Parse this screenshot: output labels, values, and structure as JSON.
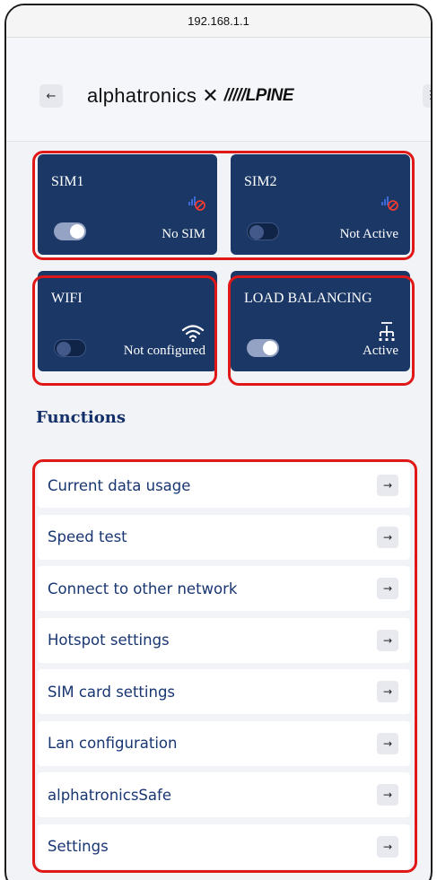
{
  "browser": {
    "url": "192.168.1.1"
  },
  "header": {
    "back_label": "←",
    "menu_label": "☰",
    "logo": {
      "part1": "alphatronics",
      "separator": "✕",
      "part2": "/////LPINE"
    }
  },
  "tiles": {
    "sim1": {
      "title": "SIM1",
      "status": "No SIM",
      "toggle": "on",
      "icon": "signal-disabled-icon"
    },
    "sim2": {
      "title": "SIM2",
      "status": "Not Active",
      "toggle": "off",
      "icon": "signal-disabled-icon"
    },
    "wifi": {
      "title": "WIFI",
      "status": "Not configured",
      "toggle": "off",
      "icon": "wifi-icon"
    },
    "load_balancing": {
      "title": "LOAD BALANCING",
      "status": "Active",
      "toggle": "on",
      "icon": "load-balancing-icon"
    }
  },
  "functions": {
    "title": "Functions",
    "arrow": "→",
    "items": [
      {
        "label": "Current data usage"
      },
      {
        "label": "Speed test"
      },
      {
        "label": "Connect to other network"
      },
      {
        "label": "Hotspot settings"
      },
      {
        "label": "SIM card settings"
      },
      {
        "label": "Lan configuration"
      },
      {
        "label": "alphatronicsSafe"
      },
      {
        "label": "Settings"
      }
    ]
  },
  "colors": {
    "tile_bg": "#1a3765",
    "highlight": "#e01818",
    "label_text": "#183672",
    "page_bg": "#f2f3f7"
  }
}
